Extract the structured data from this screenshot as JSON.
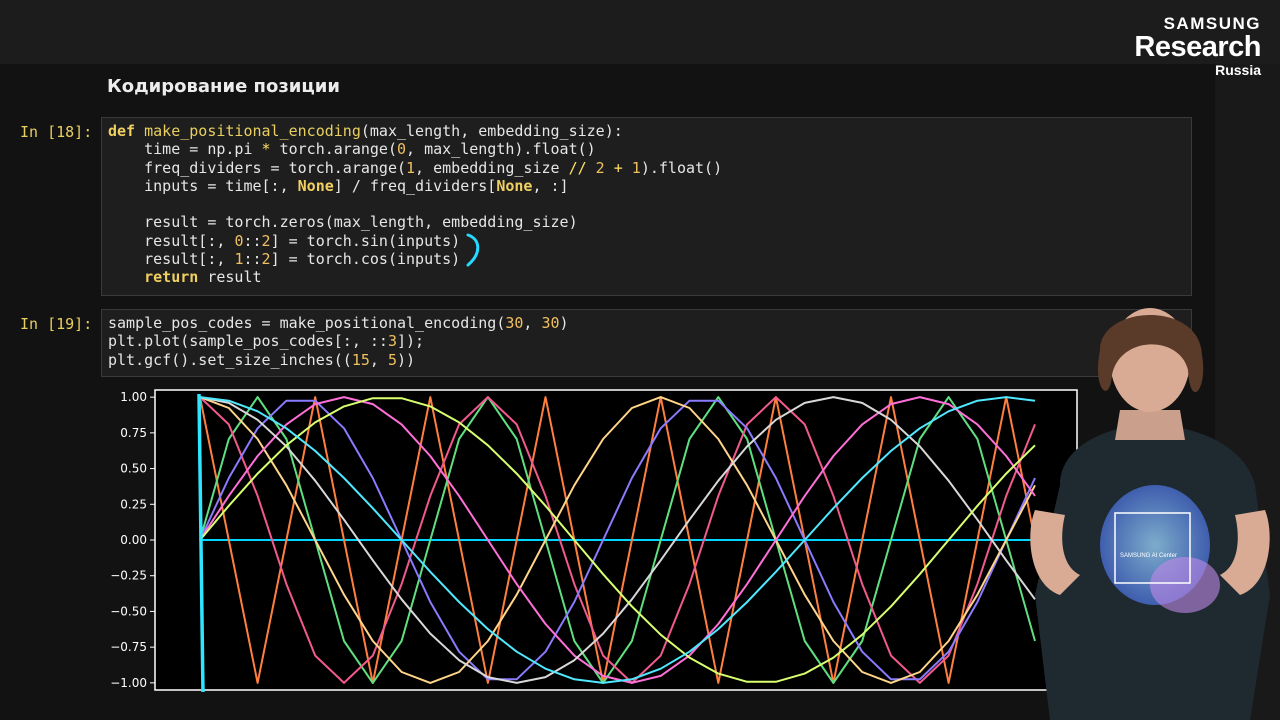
{
  "brand": {
    "line1": "SAMSUNG",
    "line2": "Research",
    "line3": "Russia"
  },
  "heading": "Кодирование позиции",
  "cells": [
    {
      "prompt": "In [18]:",
      "lines": [
        [
          [
            "kw",
            "def"
          ],
          [
            "t",
            " "
          ],
          [
            "fn",
            "make_positional_encoding"
          ],
          [
            "t",
            "(max_length, embedding_size):"
          ]
        ],
        [
          [
            "t",
            "    time = np.pi "
          ],
          [
            "op",
            "*"
          ],
          [
            "t",
            " torch.arange("
          ],
          [
            "num",
            "0"
          ],
          [
            "t",
            ", max_length).float()"
          ]
        ],
        [
          [
            "t",
            "    freq_dividers = torch.arange("
          ],
          [
            "num",
            "1"
          ],
          [
            "t",
            ", embedding_size "
          ],
          [
            "op",
            "//"
          ],
          [
            "t",
            " "
          ],
          [
            "num",
            "2"
          ],
          [
            "t",
            " "
          ],
          [
            "op",
            "+"
          ],
          [
            "t",
            " "
          ],
          [
            "num",
            "1"
          ],
          [
            "t",
            ").float()"
          ]
        ],
        [
          [
            "t",
            "    inputs = time[:, "
          ],
          [
            "none",
            "None"
          ],
          [
            "t",
            "] / freq_dividers["
          ],
          [
            "none",
            "None"
          ],
          [
            "t",
            ", :]"
          ]
        ],
        [
          [
            "t",
            ""
          ]
        ],
        [
          [
            "t",
            "    result = torch.zeros(max_length, embedding_size)"
          ]
        ],
        [
          [
            "t",
            "    result[:, "
          ],
          [
            "num",
            "0"
          ],
          [
            "t",
            "::"
          ],
          [
            "num",
            "2"
          ],
          [
            "t",
            "] = torch.sin(inputs)"
          ]
        ],
        [
          [
            "t",
            "    result[:, "
          ],
          [
            "num",
            "1"
          ],
          [
            "t",
            "::"
          ],
          [
            "num",
            "2"
          ],
          [
            "t",
            "] = torch.cos(inputs)"
          ]
        ],
        [
          [
            "t",
            "    "
          ],
          [
            "kw",
            "return"
          ],
          [
            "t",
            " result"
          ]
        ]
      ]
    },
    {
      "prompt": "In [19]:",
      "lines": [
        [
          [
            "t",
            "sample_pos_codes = make_positional_encoding("
          ],
          [
            "num",
            "30"
          ],
          [
            "t",
            ", "
          ],
          [
            "num",
            "30"
          ],
          [
            "t",
            ")"
          ]
        ],
        [
          [
            "t",
            "plt.plot(sample_pos_codes[:, ::"
          ],
          [
            "num",
            "3"
          ],
          [
            "t",
            "]);"
          ]
        ],
        [
          [
            "t",
            "plt.gcf().set_size_inches(("
          ],
          [
            "num",
            "15"
          ],
          [
            "t",
            ", "
          ],
          [
            "num",
            "5"
          ],
          [
            "t",
            "))"
          ]
        ]
      ]
    }
  ],
  "chart_data": {
    "type": "line",
    "title": "",
    "xlabel": "",
    "ylabel": "",
    "x_range": [
      0,
      29
    ],
    "ylim": [
      -1.05,
      1.05
    ],
    "ytick_labels": [
      "1.00",
      "0.75",
      "0.50",
      "0.25",
      "0.00",
      "−0.25",
      "−0.50",
      "−0.75",
      "−1.00"
    ],
    "ytick_values": [
      1.0,
      0.75,
      0.5,
      0.25,
      0.0,
      -0.25,
      -0.5,
      -0.75,
      -1.0
    ],
    "series_formula": "column 3k of positional encoding: sin/cos(pi*t/(d+1)), t=0..29",
    "columns": [
      0,
      3,
      6,
      9,
      12,
      15,
      18,
      21,
      24,
      27
    ],
    "colors": [
      "#00d4ff",
      "#ff7f3f",
      "#5fe080",
      "#f05a8c",
      "#8a7bff",
      "#ffd58a",
      "#ff6fd8",
      "#d8d8d8",
      "#d8ff70",
      "#50e8ff"
    ]
  },
  "speaker_shirt": "SAMSUNG AI Center"
}
